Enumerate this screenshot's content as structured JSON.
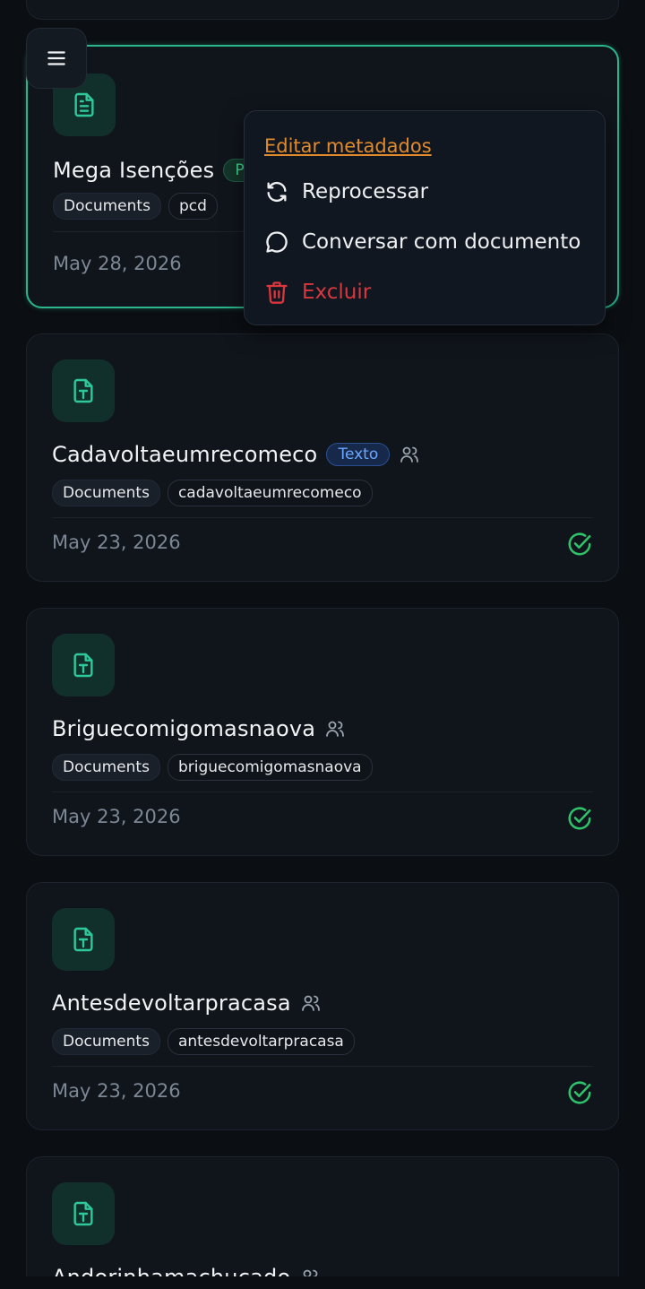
{
  "colors": {
    "background": "#0b0e13",
    "card": "#10151c",
    "accent": "#2bb58a",
    "warning": "#e08a2b",
    "danger": "#d9363e",
    "success": "#2ec36a",
    "info": "#6aa6ff"
  },
  "header": {
    "menu_icon": "hamburger-icon"
  },
  "selected_card": {
    "title": "Mega Isenções",
    "type_badge": "Pr",
    "tags": [
      "Documents",
      "pcd"
    ],
    "date": "May 28, 2026"
  },
  "context_menu": {
    "edit_metadata": "Editar metadados",
    "reprocess": "Reprocessar",
    "chat": "Conversar com documento",
    "delete": "Excluir"
  },
  "cards": [
    {
      "title": "Cadavoltaeumrecomeco",
      "type_badge": "Texto",
      "tags": [
        "Documents",
        "cadavoltaeumrecomeco"
      ],
      "date": "May 23, 2026"
    },
    {
      "title": "Briguecomigomasnaova",
      "tags": [
        "Documents",
        "briguecomigomasnaova"
      ],
      "date": "May 23, 2026"
    },
    {
      "title": "Antesdevoltarpracasa",
      "tags": [
        "Documents",
        "antesdevoltarpracasa"
      ],
      "date": "May 23, 2026"
    },
    {
      "title": "Andorinhamachucado"
    }
  ]
}
